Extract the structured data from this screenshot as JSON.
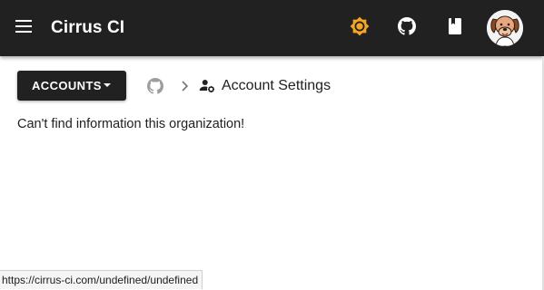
{
  "appbar": {
    "title": "Cirrus CI",
    "icons": [
      "menu-icon",
      "theme-brightness-icon",
      "github-icon",
      "book-icon",
      "avatar"
    ],
    "theme_icon_color": "#f5a623",
    "background": "#212121"
  },
  "toolbar": {
    "accounts_label": "ACCOUNTS",
    "breadcrumb": {
      "root_icon": "github-icon",
      "separator_icon": "chevron-right-icon",
      "settings_icon": "account-settings-icon",
      "label": "Account Settings"
    }
  },
  "main": {
    "message": "Can't find information this organization!"
  },
  "status_bar": {
    "url": "https://cirrus-ci.com/undefined/undefined"
  }
}
